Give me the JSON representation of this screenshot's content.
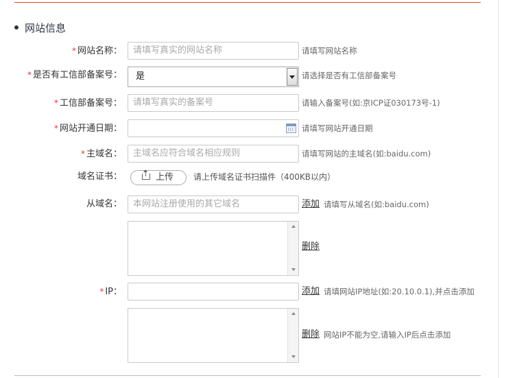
{
  "section": {
    "title": "网站信息"
  },
  "site_name": {
    "required_mark": "*",
    "label": "网站名称：",
    "placeholder": "请填写真实的网站名称",
    "hint": "请填写网站名称"
  },
  "icp_filed": {
    "required_mark": "*",
    "label": "是否有工信部备案号：",
    "selected": "是",
    "hint": "请选择是否有工信部备案号"
  },
  "icp_number": {
    "required_mark": "*",
    "label": "工信部备案号：",
    "placeholder": "请填写真实的备案号",
    "hint": "请输入备案号(如:京ICP证030173号-1)"
  },
  "open_date": {
    "required_mark": "*",
    "label": "网站开通日期：",
    "value": "",
    "hint": "请填写网站开通日期"
  },
  "main_domain": {
    "required_mark": "*",
    "label": "主域名：",
    "placeholder": "主域名应符合域名相应规则",
    "hint": "请填写网站的主域名(如:baidu.com)"
  },
  "domain_cert": {
    "label": "域名证书：",
    "button": "上传",
    "hint": "请上传域名证书扫描件（400KB以内）"
  },
  "sub_domain": {
    "label": "从域名：",
    "placeholder": "本网站注册使用的其它域名",
    "add": "添加",
    "hint": "请填写从域名(如:baidu.com)",
    "delete": "删除"
  },
  "ip": {
    "required_mark": "*",
    "label": "IP：",
    "value": "",
    "add": "添加",
    "hint": "请填网站IP地址(如:20.10.0.1),并点击添加",
    "delete": "删除",
    "delete_hint": "网站IP不能为空,请输入IP后点击添加"
  }
}
